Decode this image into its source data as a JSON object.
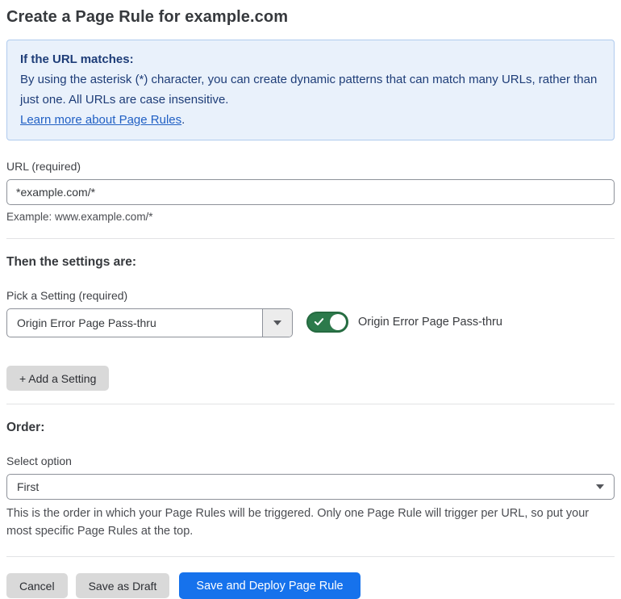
{
  "page": {
    "title": "Create a Page Rule for example.com"
  },
  "info_box": {
    "heading": "If the URL matches:",
    "body": "By using the asterisk (*) character, you can create dynamic patterns that can match many URLs, rather than just one. All URLs are case insensitive.",
    "link_label": "Learn more about Page Rules",
    "link_suffix": "."
  },
  "url_field": {
    "label": "URL (required)",
    "value": "*example.com/*",
    "helper": "Example: www.example.com/*"
  },
  "settings_section": {
    "heading": "Then the settings are:",
    "picker_label": "Pick a Setting (required)",
    "picker_value": "Origin Error Page Pass-thru",
    "toggle_state": "on",
    "toggle_label": "Origin Error Page Pass-thru",
    "add_button_label": "+ Add a Setting"
  },
  "order_section": {
    "heading": "Order:",
    "select_label": "Select option",
    "select_value": "First",
    "helper": "This is the order in which your Page Rules will be triggered. Only one Page Rule will trigger per URL, so put your most specific Page Rules at the top."
  },
  "footer": {
    "cancel_label": "Cancel",
    "save_draft_label": "Save as Draft",
    "save_deploy_label": "Save and Deploy Page Rule"
  },
  "colors": {
    "primary_blue": "#1672ec",
    "toggle_green": "#2c7a4b",
    "toggle_green_border": "#256a40",
    "info_bg": "#e9f1fb",
    "info_border": "#b0cbee",
    "info_text": "#1e3d78",
    "link_blue": "#2160c4",
    "gray_button_bg": "#d9d9d9",
    "input_border": "#8d9199",
    "divider": "#e2e3e5"
  },
  "icons": {
    "dropdown_arrow": "triangle-down",
    "toggle_check": "check"
  }
}
